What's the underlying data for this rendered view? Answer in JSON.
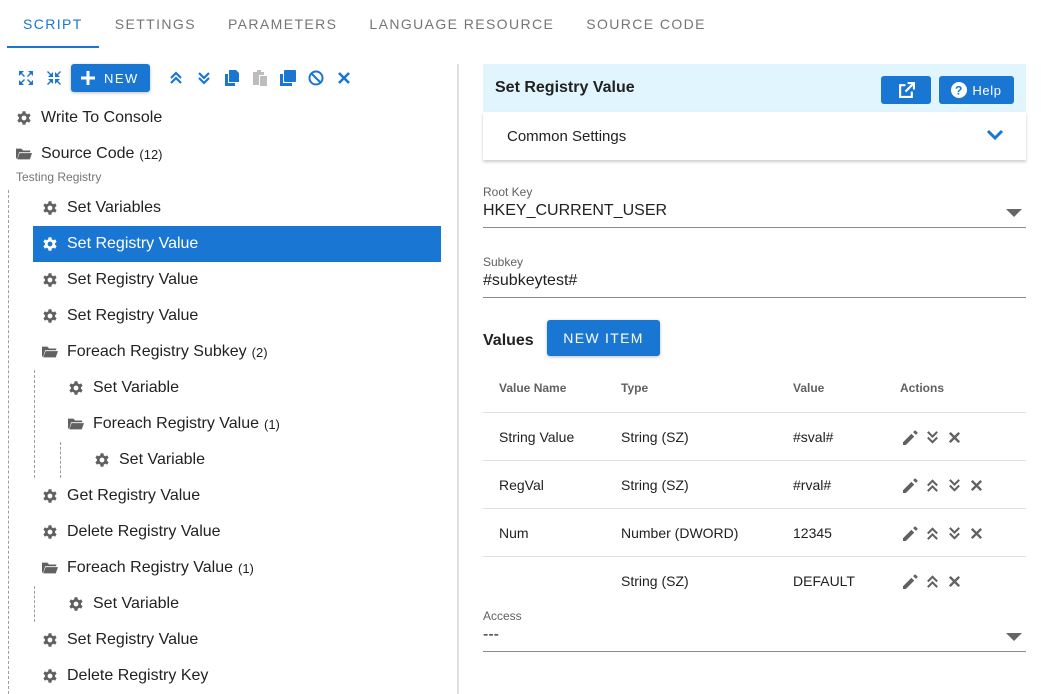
{
  "tabs": [
    "Script",
    "Settings",
    "Parameters",
    "Language Resource",
    "Source Code"
  ],
  "toolbar": {
    "new_label": "NEW"
  },
  "tree": {
    "group_label": "Testing Registry",
    "nodes": [
      {
        "label": "Write To Console",
        "count": ""
      },
      {
        "label": "Source Code",
        "count": "(12)"
      },
      {
        "label": "Set Variables",
        "count": ""
      },
      {
        "label": "Set Registry Value",
        "count": ""
      },
      {
        "label": "Set Registry Value",
        "count": ""
      },
      {
        "label": "Set Registry Value",
        "count": ""
      },
      {
        "label": "Foreach Registry Subkey",
        "count": "(2)"
      },
      {
        "label": "Set Variable",
        "count": ""
      },
      {
        "label": "Foreach Registry Value",
        "count": "(1)"
      },
      {
        "label": "Set Variable",
        "count": ""
      },
      {
        "label": "Get Registry Value",
        "count": ""
      },
      {
        "label": "Delete Registry Value",
        "count": ""
      },
      {
        "label": "Foreach Registry Value",
        "count": "(1)"
      },
      {
        "label": "Set Variable",
        "count": ""
      },
      {
        "label": "Set Registry Value",
        "count": ""
      },
      {
        "label": "Delete Registry Key",
        "count": ""
      }
    ]
  },
  "panel": {
    "title": "Set Registry Value",
    "help_label": "Help",
    "common_settings": "Common Settings",
    "root_key": {
      "label": "Root Key",
      "value": "HKEY_CURRENT_USER"
    },
    "subkey": {
      "label": "Subkey",
      "value": "#subkeytest#"
    },
    "values_label": "Values",
    "new_item_label": "NEW ITEM",
    "table": {
      "headers": [
        "Value Name",
        "Type",
        "Value",
        "Actions"
      ],
      "rows": [
        {
          "name": "String Value",
          "type": "String (SZ)",
          "value": "#sval#"
        },
        {
          "name": "RegVal",
          "type": "String (SZ)",
          "value": "#rval#"
        },
        {
          "name": "Num",
          "type": "Number (DWORD)",
          "value": "12345"
        },
        {
          "name": "",
          "type": "String (SZ)",
          "value": "DEFAULT"
        }
      ]
    },
    "access": {
      "label": "Access",
      "value": "---"
    }
  },
  "colors": {
    "accent": "#1976d2",
    "header_bg": "#e1f5fe",
    "icon": "#616161"
  }
}
